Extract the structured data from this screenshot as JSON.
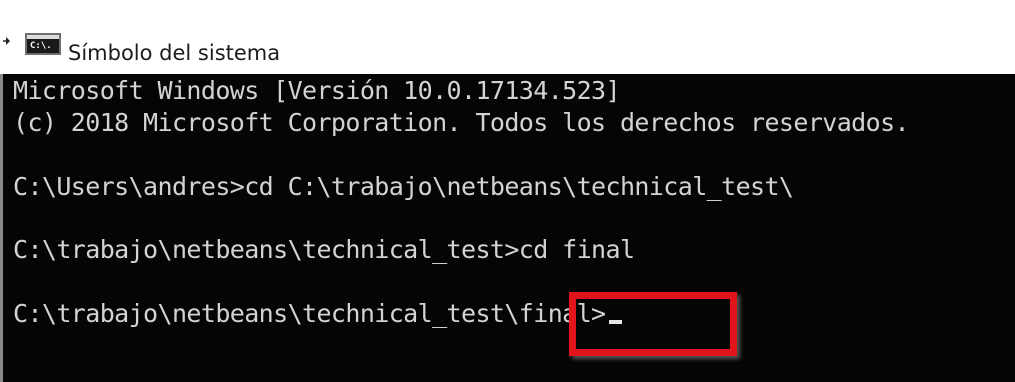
{
  "window": {
    "title": "Símbolo del sistema",
    "app_icon_text": "C:\\."
  },
  "console": {
    "lines": [
      "Microsoft Windows [Versión 10.0.17134.523]",
      "(c) 2018 Microsoft Corporation. Todos los derechos reservados.",
      "C:\\Users\\andres>cd C:\\trabajo\\netbeans\\technical_test\\",
      "C:\\trabajo\\netbeans\\technical_test>cd final",
      "C:\\trabajo\\netbeans\\technical_test\\final>"
    ]
  },
  "colors": {
    "console_bg": "#050505",
    "console_text": "#d3d3d3",
    "highlight_border": "#e1141c"
  },
  "icons": {
    "pin": "pin-arrow-icon",
    "app": "command-prompt-icon"
  }
}
